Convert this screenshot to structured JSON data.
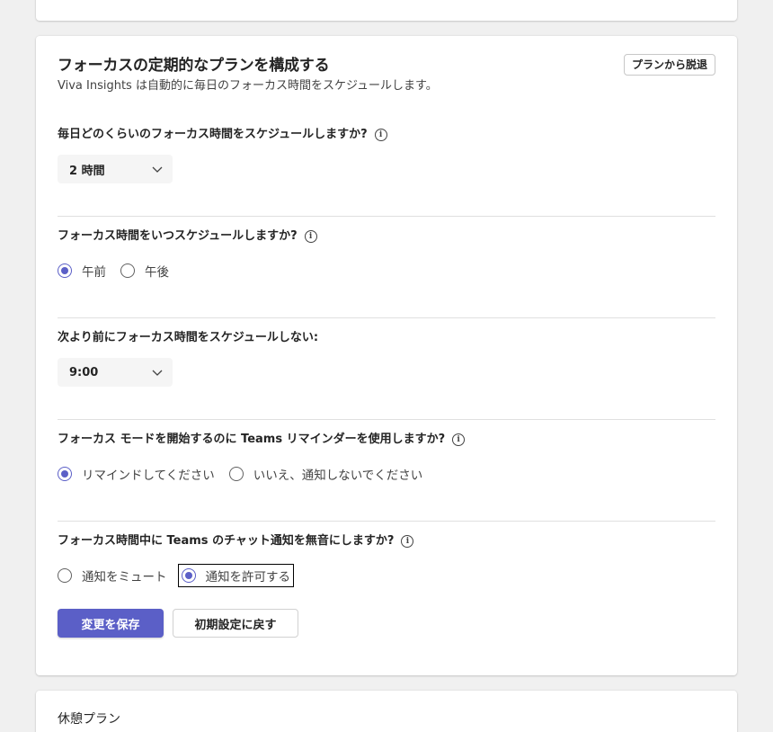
{
  "focus_plan": {
    "title": "フォーカスの定期的なプランを構成する",
    "subtitle": "Viva Insights は自動的に毎日のフォーカス時間をスケジュールします。",
    "leave_button": "プランから脱退",
    "questions": [
      {
        "label": "毎日どのくらいのフォーカス時間をスケジュールしますか?",
        "type": "select",
        "value": "2 時間",
        "has_info": true
      },
      {
        "label": "フォーカス時間をいつスケジュールしますか?",
        "type": "radio",
        "options": [
          "午前",
          "午後"
        ],
        "selected": "午前",
        "has_info": true
      },
      {
        "label": "次より前にフォーカス時間をスケジュールしない:",
        "type": "select",
        "value": "9:00",
        "has_info": false
      },
      {
        "label": "フォーカス モードを開始するのに Teams リマインダーを使用しますか?",
        "type": "radio",
        "options": [
          "リマインドしてください",
          "いいえ、通知しないでください"
        ],
        "selected": "リマインドしてください",
        "has_info": true
      },
      {
        "label": "フォーカス時間中に Teams のチャット通知を無音にしますか?",
        "type": "radio",
        "options": [
          "通知をミュート",
          "通知を許可する"
        ],
        "selected": "通知を許可する",
        "has_info": true
      }
    ],
    "save_button": "変更を保存",
    "reset_button": "初期設定に戻す"
  },
  "break_plan": {
    "title": "休憩プラン"
  },
  "colors": {
    "accent": "#5b5fc7",
    "background": "#f0f0f0"
  }
}
